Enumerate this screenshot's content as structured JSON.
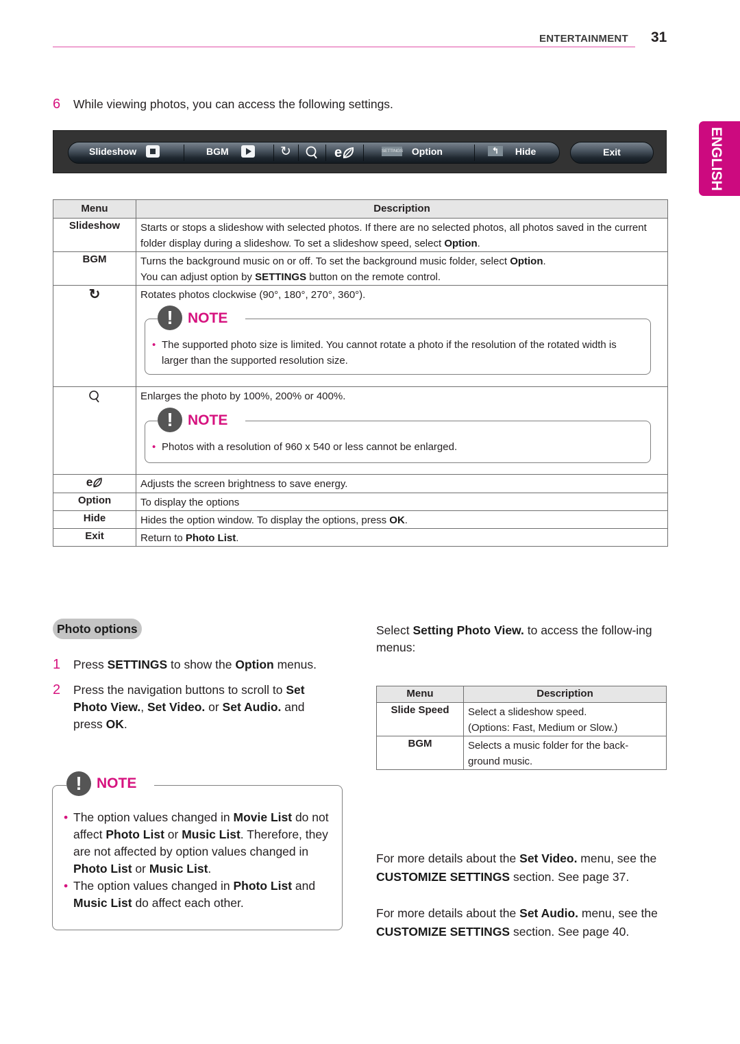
{
  "header": {
    "section": "ENTERTAINMENT",
    "page_number": "31",
    "accent_color": "#d6137f"
  },
  "language_tab": "ENGLISH",
  "step6": {
    "number": "6",
    "text": "While viewing photos, you can access the following settings."
  },
  "osd": {
    "slideshow": "Slideshow",
    "bgm": "BGM",
    "settings_badge": "SETTINGS",
    "option": "Option",
    "hide": "Hide",
    "exit": "Exit",
    "icons": [
      "stop-icon",
      "play-icon",
      "rotate-icon",
      "zoom-icon",
      "energy-saving-icon",
      "settings-icon",
      "back-icon"
    ]
  },
  "table1": {
    "headers": [
      "Menu",
      "Description"
    ],
    "rows": [
      {
        "menu": "Slideshow",
        "desc_a": "Starts or stops a slideshow with selected photos. If there are no selected photos, all photos saved in the current folder display during a slideshow. To set a slideshow speed, select ",
        "desc_b": "Option",
        "desc_c": "."
      },
      {
        "menu": "BGM",
        "line1_a": "Turns the background music on or off. To set the background music folder, select ",
        "line1_b": "Option",
        "line1_c": ".",
        "line2_a": "You can adjust option by ",
        "line2_b": "SETTINGS",
        "line2_c": " button on the remote control."
      },
      {
        "menu_icon": "rotate-icon",
        "desc": "Rotates photos clockwise (90°, 180°, 270°, 360°).",
        "note_title": "NOTE",
        "note_text": "The supported photo size is limited. You cannot rotate a photo if the resolution of the rotated width is larger than the supported resolution size."
      },
      {
        "menu_icon": "zoom-icon",
        "desc": "Enlarges the photo by 100%, 200% or 400%.",
        "note_title": "NOTE",
        "note_text": "Photos with a resolution of 960 x 540 or less cannot be enlarged."
      },
      {
        "menu_icon": "energy-saving-icon",
        "desc": "Adjusts the screen brightness to save energy."
      },
      {
        "menu": "Option",
        "desc": "To display the options"
      },
      {
        "menu": "Hide",
        "desc_a": "Hides the option window. To display the options, press ",
        "desc_b": "OK",
        "desc_c": "."
      },
      {
        "menu": "Exit",
        "desc_a": "Return to ",
        "desc_b": "Photo List",
        "desc_c": "."
      }
    ]
  },
  "photo_options": {
    "title": "Photo options",
    "step1": {
      "number": "1",
      "a": "Press ",
      "b": "SETTINGS",
      "c": " to show the ",
      "d": "Option",
      "e": " menus."
    },
    "step2": {
      "number": "2",
      "a": "Press the navigation buttons to scroll to ",
      "b": "Set Photo View.",
      "c": ", ",
      "d": "Set Video.",
      "e": " or ",
      "f": "Set Audio.",
      "g": " and press ",
      "h": "OK",
      "i": "."
    },
    "note": {
      "title": "NOTE",
      "bullet1": {
        "a": "The option values changed in ",
        "b": "Movie List",
        "c": " do not affect ",
        "d": "Photo List",
        "e": " or ",
        "f": "Music List",
        "g": ". Therefore, they are not affected by option values changed in ",
        "h": "Photo List",
        "i": " or ",
        "j": "Music List",
        "k": "."
      },
      "bullet2": {
        "a": "The option values changed in ",
        "b": "Photo List",
        "c": " and ",
        "d": "Music List",
        "e": " do affect each other."
      }
    }
  },
  "right": {
    "intro": {
      "a": "Select ",
      "b": "Setting Photo View.",
      "c": " to access the follow-ing menus:"
    },
    "table2": {
      "headers": [
        "Menu",
        "Description"
      ],
      "rows": [
        {
          "menu": "Slide Speed",
          "line1": "Select a slideshow speed.",
          "line2": "(Options: Fast, Medium or Slow.)"
        },
        {
          "menu": "BGM",
          "line1": "Selects a music folder for the back-",
          "line2": "ground music."
        }
      ]
    },
    "video_ref": {
      "a": "For more details about the ",
      "b": "Set Video.",
      "c": " menu, see the ",
      "d": "CUSTOMIZE SETTINGS",
      "e": " section. See page 37."
    },
    "audio_ref": {
      "a": "For more details about the ",
      "b": "Set Audio.",
      "c": " menu, see the ",
      "d": "CUSTOMIZE SETTINGS",
      "e": " section. See page 40."
    }
  }
}
